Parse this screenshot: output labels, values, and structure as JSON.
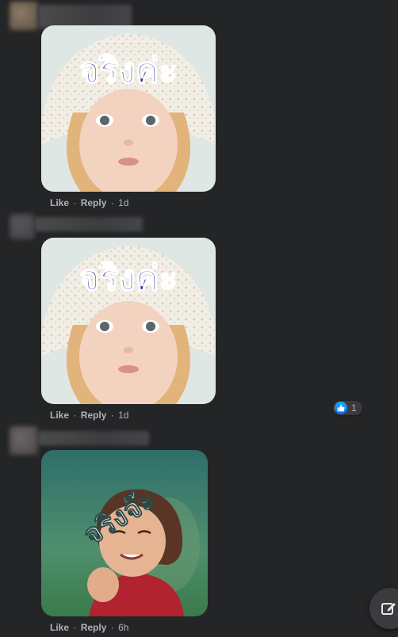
{
  "comments": [
    {
      "sticker_text": "จริงค่ะ",
      "like_label": "Like",
      "reply_label": "Reply",
      "separator": "·",
      "time": "1d"
    },
    {
      "sticker_text": "จริงค่ะ",
      "like_label": "Like",
      "reply_label": "Reply",
      "separator": "·",
      "time": "1d",
      "reaction_count": "1"
    },
    {
      "sticker_text": "จริงจ๊ะ",
      "like_label": "Like",
      "reply_label": "Reply",
      "separator": "·",
      "time": "6h"
    }
  ],
  "icons": {
    "like_reaction": "thumbs-up-icon",
    "compose": "compose-icon"
  },
  "colors": {
    "background": "#242526",
    "meta_text": "#b0b3b8",
    "like_blue": "#1877f2",
    "sticker_text_blue": "#1a2a9c"
  }
}
